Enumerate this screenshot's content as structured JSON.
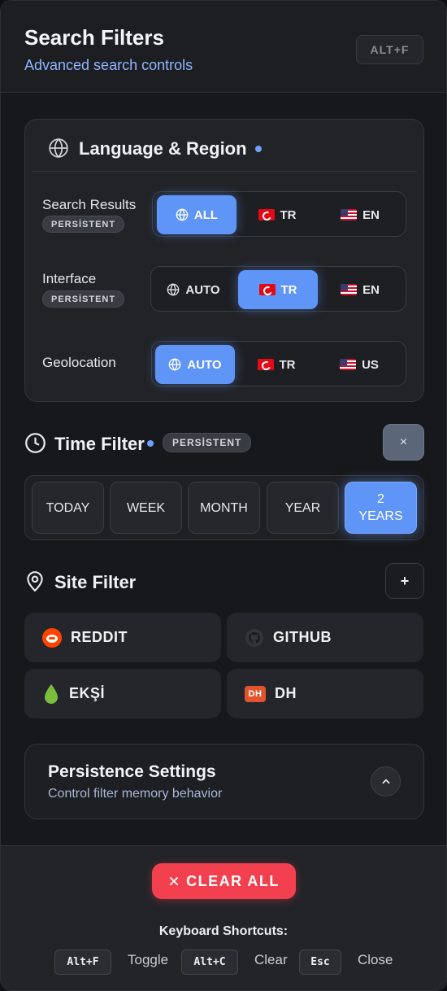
{
  "header": {
    "title": "Search Filters",
    "subtitle": "Advanced search controls",
    "shortcut_badge": "ALT+F"
  },
  "language_region": {
    "title": "Language & Region",
    "rows": [
      {
        "label": "Search Results",
        "tag": "PERSİSTENT",
        "options": [
          {
            "icon": "globe-icon",
            "label": "ALL",
            "active": true
          },
          {
            "icon": "flag-tr-icon",
            "label": "TR",
            "active": false
          },
          {
            "icon": "flag-us-icon",
            "label": "EN",
            "active": false
          }
        ]
      },
      {
        "label": "Interface",
        "tag": "PERSİSTENT",
        "options": [
          {
            "icon": "globe-icon",
            "label": "AUTO",
            "active": false
          },
          {
            "icon": "flag-tr-icon",
            "label": "TR",
            "active": true
          },
          {
            "icon": "flag-us-icon",
            "label": "EN",
            "active": false
          }
        ]
      },
      {
        "label": "Geolocation",
        "tag": "",
        "options": [
          {
            "icon": "globe-icon",
            "label": "AUTO",
            "active": true
          },
          {
            "icon": "flag-tr-icon",
            "label": "TR",
            "active": false
          },
          {
            "icon": "flag-us-icon",
            "label": "US",
            "active": false
          }
        ]
      }
    ]
  },
  "time_filter": {
    "title": "Time Filter",
    "tag": "PERSİSTENT",
    "close_label": "×",
    "options": [
      {
        "label": "TODAY",
        "active": false
      },
      {
        "label": "WEEK",
        "active": false
      },
      {
        "label": "MONTH",
        "active": false
      },
      {
        "label": "YEAR",
        "active": false
      },
      {
        "label": "2 YEARS",
        "active": true
      }
    ]
  },
  "site_filter": {
    "title": "Site Filter",
    "add_label": "+",
    "sites": [
      {
        "icon": "reddit-icon",
        "label": "REDDIT"
      },
      {
        "icon": "github-icon",
        "label": "GITHUB"
      },
      {
        "icon": "eksi-drop-icon",
        "label": "EKŞİ"
      },
      {
        "icon": "dh-icon",
        "label": "DH",
        "logo_text": "DH"
      }
    ]
  },
  "persistence": {
    "title": "Persistence Settings",
    "subtitle": "Control filter memory behavior"
  },
  "footer": {
    "clear_label": "CLEAR ALL",
    "shortcuts_title": "Keyboard Shortcuts:",
    "shortcuts": [
      {
        "key": "Alt+F",
        "action": "Toggle"
      },
      {
        "key": "Alt+C",
        "action": "Clear"
      },
      {
        "key": "Esc",
        "action": "Close"
      }
    ]
  },
  "colors": {
    "accent": "#5f95f6",
    "danger": "#f3404f",
    "background": "#17181b"
  }
}
